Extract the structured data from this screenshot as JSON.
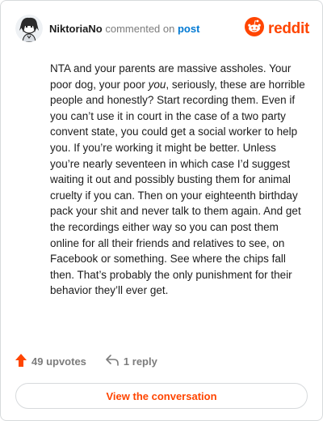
{
  "header": {
    "username": "NiktoriaNo",
    "action_text": "commented on",
    "post_link": "post",
    "brand_name": "reddit"
  },
  "comment": {
    "text_before_italic": "NTA and your parents are massive assholes. Your poor dog, your poor ",
    "italic_word": "you",
    "text_after_italic": ", seriously, these are horrible people and honestly? Start recording them. Even if you can’t use it in court in the case of a two party convent state, you could get a social worker to help you. If you’re working it might be better. Unless you’re nearly seventeen in which case I’d suggest waiting it out and possibly busting them for animal cruelty if you can. Then on your eighteenth birthday pack your shit and never talk to them again. And get the recordings either way so you can post them online for all their friends and relatives to see, on Facebook or something. See where the chips fall then. That’s probably the only punishment for their behavior they’ll ever get."
  },
  "actions": {
    "upvotes_label": "49 upvotes",
    "replies_label": "1 reply"
  },
  "cta": {
    "label": "View the conversation"
  },
  "colors": {
    "brand": "#ff4500",
    "link": "#0079d3",
    "muted": "#7c7c7c",
    "border": "#d7dadc"
  },
  "icons": {
    "avatar": "user-avatar",
    "brand_logo": "reddit-logo-icon",
    "upvote": "upvote-arrow-icon",
    "reply": "reply-arrow-icon"
  }
}
